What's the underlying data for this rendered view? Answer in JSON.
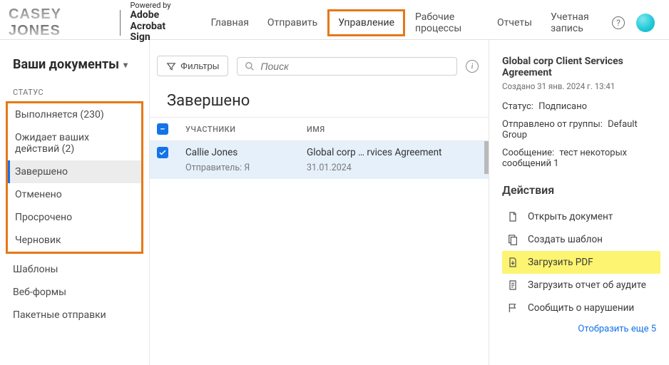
{
  "header": {
    "user_logo": "CASEY JONES",
    "powered_small": "Powered by",
    "powered_line1": "Adobe",
    "powered_line2": "Acrobat Sign",
    "nav": [
      "Главная",
      "Отправить",
      "Управление",
      "Рабочие процессы",
      "Отчеты",
      "Учетная запись"
    ],
    "nav_active_index": 2
  },
  "sidebar": {
    "docs_title": "Ваши документы",
    "status_label": "СТАТУС",
    "status_items": [
      "Выполняется (230)",
      "Ожидает ваших действий (2)",
      "Завершено",
      "Отменено",
      "Просрочено",
      "Черновик"
    ],
    "status_selected_index": 2,
    "other_items": [
      "Шаблоны",
      "Веб-формы",
      "Пакетные отправки"
    ]
  },
  "toolbar": {
    "filters_label": "Фильтры",
    "search_placeholder": "Поиск"
  },
  "table": {
    "section_title": "Завершено",
    "columns": {
      "participants": "УЧАСТНИКИ",
      "name": "ИМЯ"
    },
    "rows": [
      {
        "checked": true,
        "participant": "Callie Jones",
        "sender_label": "Отправитель: Я",
        "name": "Global corp …  rvices Agreement",
        "date": "31.01.2024"
      }
    ]
  },
  "detail": {
    "title": "Global corp Client Services Agreement",
    "created": "Создано 31 янв. 2024 г. 13:41",
    "status_label": "Статус:",
    "status_value": "Подписано",
    "group_label": "Отправлено от группы:",
    "group_value": "Default Group",
    "message_label": "Сообщение:",
    "message_value": "тест некоторых сообщений 1",
    "actions_header": "Действия",
    "actions": [
      "Открыть документ",
      "Создать шаблон",
      "Загрузить PDF",
      "Загрузить отчет об аудите",
      "Сообщить о нарушении"
    ],
    "highlight_index": 2,
    "show_more": "Отобразить еще 5"
  }
}
